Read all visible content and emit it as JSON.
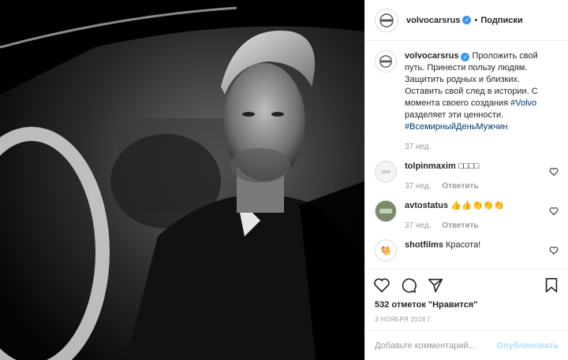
{
  "photo": {
    "description_icon": "man-in-car-photo"
  },
  "header": {
    "username": "volvocarsrus",
    "separator": "•",
    "follow_label": "Подписки"
  },
  "caption": {
    "username": "volvocarsrus",
    "text": "Проложить свой путь. Принести пользу людям. Защитить родных и близких. Оставить свой след в истории. С момента своего создания ",
    "tag1": "#Volvo",
    "text2": " разделяет эти ценности. ",
    "tag2": "#ВсемирныйДеньМужчин",
    "time": "37 нед."
  },
  "comments": [
    {
      "username": "tolpinmaxim",
      "text": "□□□□",
      "time": "37 нед.",
      "reply": "Ответить"
    },
    {
      "username": "avtostatus",
      "text": "👍👍👏👏👏",
      "time": "37 нед.",
      "reply": "Ответить"
    },
    {
      "username": "shotfilms",
      "text": "Красота!",
      "time": "",
      "reply": ""
    }
  ],
  "likes": "532 отметок \"Нравится\"",
  "date": "3 НОЯБРЯ 2018 Г.",
  "add_comment": {
    "placeholder": "Добавьте комментарий...",
    "publish_label": "Опубликовать"
  }
}
